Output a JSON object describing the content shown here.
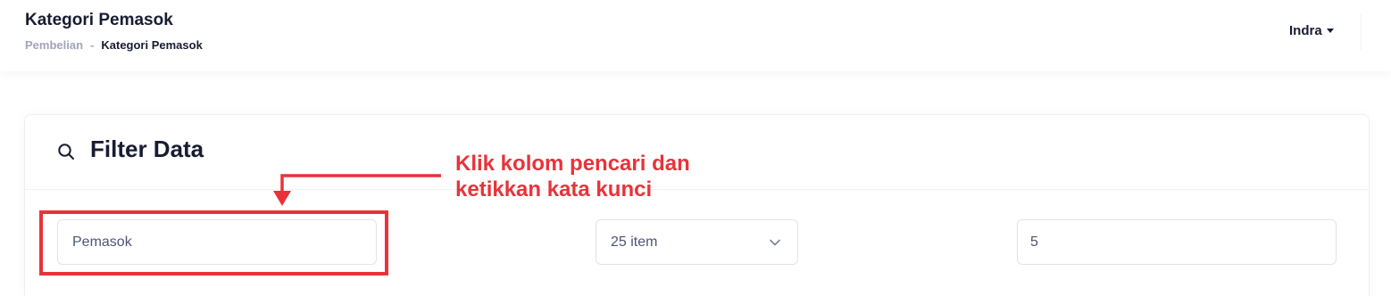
{
  "header": {
    "title": "Kategori Pemasok",
    "breadcrumb": {
      "parent": "Pembelian",
      "separator": "-",
      "current": "Kategori Pemasok"
    },
    "user": "Indra"
  },
  "filter": {
    "title": "Filter Data",
    "search_value": "Pemasok",
    "per_page_value": "25 item",
    "page_value": "5"
  },
  "annotation": {
    "line1": "Klik kolom pencari dan",
    "line2": "ketikkan kata kunci",
    "color": "#e8333a"
  }
}
